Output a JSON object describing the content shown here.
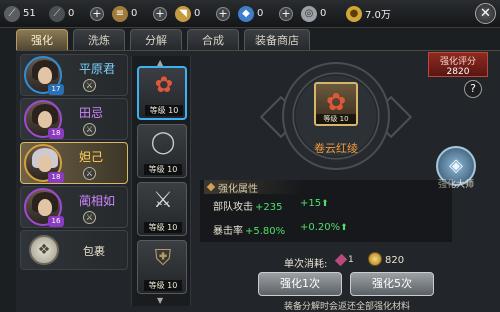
{
  "resources": [
    {
      "icon": "blade-icon",
      "value": "51"
    },
    {
      "icon": "blade-icon",
      "value": "0"
    },
    {
      "icon": "scroll-icon",
      "value": "0"
    },
    {
      "icon": "horn-icon",
      "value": "0"
    },
    {
      "icon": "crystal-icon",
      "value": "0"
    },
    {
      "icon": "silver-coin-icon",
      "value": "0"
    },
    {
      "icon": "gold-coin-icon",
      "value": "7.0万"
    }
  ],
  "tabs": [
    "强化",
    "洗炼",
    "分解",
    "合成",
    "装备商店"
  ],
  "heroes": [
    {
      "name": "平原君",
      "level": "17",
      "quality": "blue"
    },
    {
      "name": "田忌",
      "level": "18",
      "quality": "purple"
    },
    {
      "name": "妲己",
      "level": "18",
      "quality": "gold"
    },
    {
      "name": "蔺相如",
      "level": "16",
      "quality": "purple"
    }
  ],
  "bag_label": "包裹",
  "equipment": [
    {
      "name": "flower-item",
      "level": "等级 10"
    },
    {
      "name": "ring-item",
      "level": "等级 10"
    },
    {
      "name": "sword-item",
      "level": "等级 10"
    },
    {
      "name": "armor-item",
      "level": "等级 10"
    }
  ],
  "selected_item": {
    "name": "卷云红绫",
    "level": "等级 10"
  },
  "score": {
    "label": "强化评分",
    "value": "2820"
  },
  "master_label": "强化大师",
  "attributes": {
    "title": "强化属性",
    "rows": [
      {
        "key": "部队攻击",
        "value": "+235",
        "inc": "+15"
      },
      {
        "key": "暴击率",
        "value": "+5.80%",
        "inc": "+0.20%"
      }
    ]
  },
  "cost": {
    "label": "单次消耗:",
    "gem_value": "1",
    "coin_value": "820"
  },
  "buttons": {
    "once": "强化1次",
    "five": "强化5次"
  },
  "hint": "装备分解时会返还全部强化材料",
  "colors": {
    "accent": "#d8b867",
    "increase": "#4fe06a",
    "title": "#f59a3a"
  }
}
